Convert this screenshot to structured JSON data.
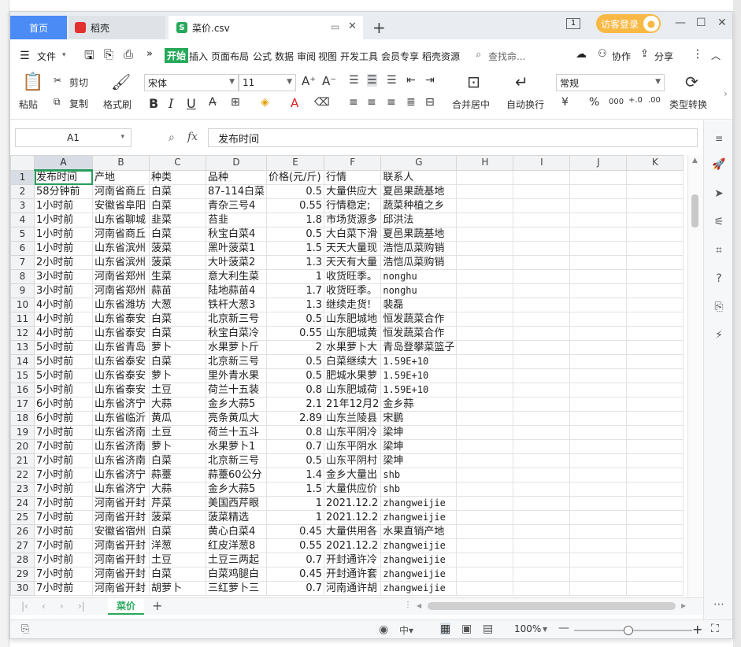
{
  "titlebar": {
    "tabs": [
      {
        "label": "首页"
      },
      {
        "label": "稻壳"
      },
      {
        "label": "菜价.csv"
      }
    ],
    "login_label": "访客登录",
    "page_count": "1"
  },
  "menu": {
    "file_label": "文件",
    "items": [
      "开始",
      "插入",
      "页面布局",
      "公式",
      "数据",
      "审阅",
      "视图",
      "开发工具",
      "会员专享",
      "稻壳资源"
    ],
    "search_label": "查找命...",
    "collab_label": "协作",
    "share_label": "分享"
  },
  "ribbon": {
    "paste": "粘贴",
    "cut": "剪切",
    "copy": "复制",
    "format_painter": "格式刷",
    "font_name": "宋体",
    "font_size": "11",
    "merge_center": "合并居中",
    "wrap_text": "自动换行",
    "number_format": "常规",
    "type_convert": "类型转换"
  },
  "formula_bar": {
    "cell_ref": "A1",
    "fx": "fx",
    "content": "发布时间"
  },
  "sheet": {
    "columns": [
      "A",
      "B",
      "C",
      "D",
      "E",
      "F",
      "G",
      "H",
      "I",
      "J",
      "K"
    ],
    "rows": [
      [
        "发布时间",
        "产地",
        "种类",
        "品种",
        "价格(元/斤)",
        "行情",
        "联系人"
      ],
      [
        "58分钟前",
        "河南省商丘",
        "白菜",
        "87-114白菜",
        "0.5",
        "大量供应大",
        "夏邑果蔬基地"
      ],
      [
        "1小时前",
        "安徽省阜阳",
        "白菜",
        "青杂三号4",
        "0.55",
        "行情稳定;",
        "蔬菜种植之乡"
      ],
      [
        "1小时前",
        "山东省聊城",
        "韭菜",
        "苔韭",
        "1.8",
        "市场货源多",
        "邱洪法"
      ],
      [
        "1小时前",
        "河南省商丘",
        "白菜",
        "秋宝白菜4",
        "0.5",
        "大白菜下滑",
        "夏邑果蔬基地"
      ],
      [
        "1小时前",
        "山东省滨州",
        "菠菜",
        "黑叶菠菜1",
        "1.5",
        "天天大量现",
        "浩恺瓜菜购销"
      ],
      [
        "2小时前",
        "山东省滨州",
        "菠菜",
        "大叶菠菜2",
        "1.3",
        "天天有大量",
        "浩恺瓜菜购销"
      ],
      [
        "3小时前",
        "河南省郑州",
        "生菜",
        "意大利生菜",
        "1",
        "收货旺季。",
        "nonghu"
      ],
      [
        "3小时前",
        "河南省郑州",
        "蒜苗",
        "陆地蒜苗4",
        "1.7",
        "收货旺季。",
        "nonghu"
      ],
      [
        "4小时前",
        "山东省潍坊",
        "大葱",
        "铁杆大葱3",
        "1.3",
        "继续走货!",
        "裴磊"
      ],
      [
        "4小时前",
        "山东省泰安",
        "白菜",
        "北京新三号",
        "0.5",
        "山东肥城地",
        "恒发蔬菜合作"
      ],
      [
        "4小时前",
        "山东省泰安",
        "白菜",
        "秋宝白菜冷",
        "0.55",
        "山东肥城黄",
        "恒发蔬菜合作"
      ],
      [
        "5小时前",
        "山东省青岛",
        "萝卜",
        "水果萝卜斤",
        "2",
        "水果萝卜大",
        "青岛登攀菜篮子"
      ],
      [
        "5小时前",
        "山东省泰安",
        "白菜",
        "北京新三号",
        "0.5",
        "白菜继续大",
        "1.59E+10"
      ],
      [
        "5小时前",
        "山东省泰安",
        "萝卜",
        "里外青水果",
        "0.5",
        "肥城水果萝",
        "1.59E+10"
      ],
      [
        "5小时前",
        "山东省泰安",
        "土豆",
        "荷兰十五装",
        "0.8",
        "山东肥城荷",
        "1.59E+10"
      ],
      [
        "6小时前",
        "山东省济宁",
        "大蒜",
        "金乡大蒜5",
        "2.1",
        "21年12月2",
        "金乡蒜"
      ],
      [
        "6小时前",
        "山东省临沂",
        "黄瓜",
        "亮条黄瓜大",
        "2.89",
        "山东兰陵县",
        "宋鹏"
      ],
      [
        "7小时前",
        "山东省济南",
        "土豆",
        "荷兰十五斗",
        "0.8",
        "山东平阴冷",
        "梁坤"
      ],
      [
        "7小时前",
        "山东省济南",
        "萝卜",
        "水果萝卜1",
        "0.7",
        "山东平阴水",
        "梁坤"
      ],
      [
        "7小时前",
        "山东省济南",
        "白菜",
        "北京新三号",
        "0.5",
        "山东平阴村",
        "梁坤"
      ],
      [
        "7小时前",
        "山东省济宁",
        "蒜薹",
        "蒜薹60公分",
        "1.4",
        "金乡大量出",
        "shb"
      ],
      [
        "7小时前",
        "山东省济宁",
        "大蒜",
        "金乡大蒜5",
        "1.5",
        "大量供应价",
        "shb"
      ],
      [
        "7小时前",
        "河南省开封",
        "芹菜",
        "美国西芹眼",
        "1",
        "2021.12.2",
        "zhangweijie"
      ],
      [
        "7小时前",
        "河南省开封",
        "菠菜",
        "菠菜精选",
        "1",
        "2021.12.2",
        "zhangweijie"
      ],
      [
        "7小时前",
        "安徽省宿州",
        "白菜",
        "黄心白菜4",
        "0.45",
        "大量供用各",
        "水果直销产地"
      ],
      [
        "7小时前",
        "河南省开封",
        "洋葱",
        "红皮洋葱8",
        "0.55",
        "2021.12.2",
        "zhangweijie"
      ],
      [
        "7小时前",
        "河南省开封",
        "土豆",
        "土豆三两起",
        "0.7",
        "开封通许冷",
        "zhangweijie"
      ],
      [
        "7小时前",
        "河南省开封",
        "白菜",
        "白菜鸡腿白",
        "0.45",
        "开封通许套",
        "zhangweijie"
      ],
      [
        "7小时前",
        "河南省开封",
        "胡萝卜",
        "三红萝卜三",
        "0.7",
        "河南通许胡",
        "zhangweijie"
      ]
    ]
  },
  "sheet_tab": "菜价",
  "status": {
    "zoom": "100%"
  }
}
